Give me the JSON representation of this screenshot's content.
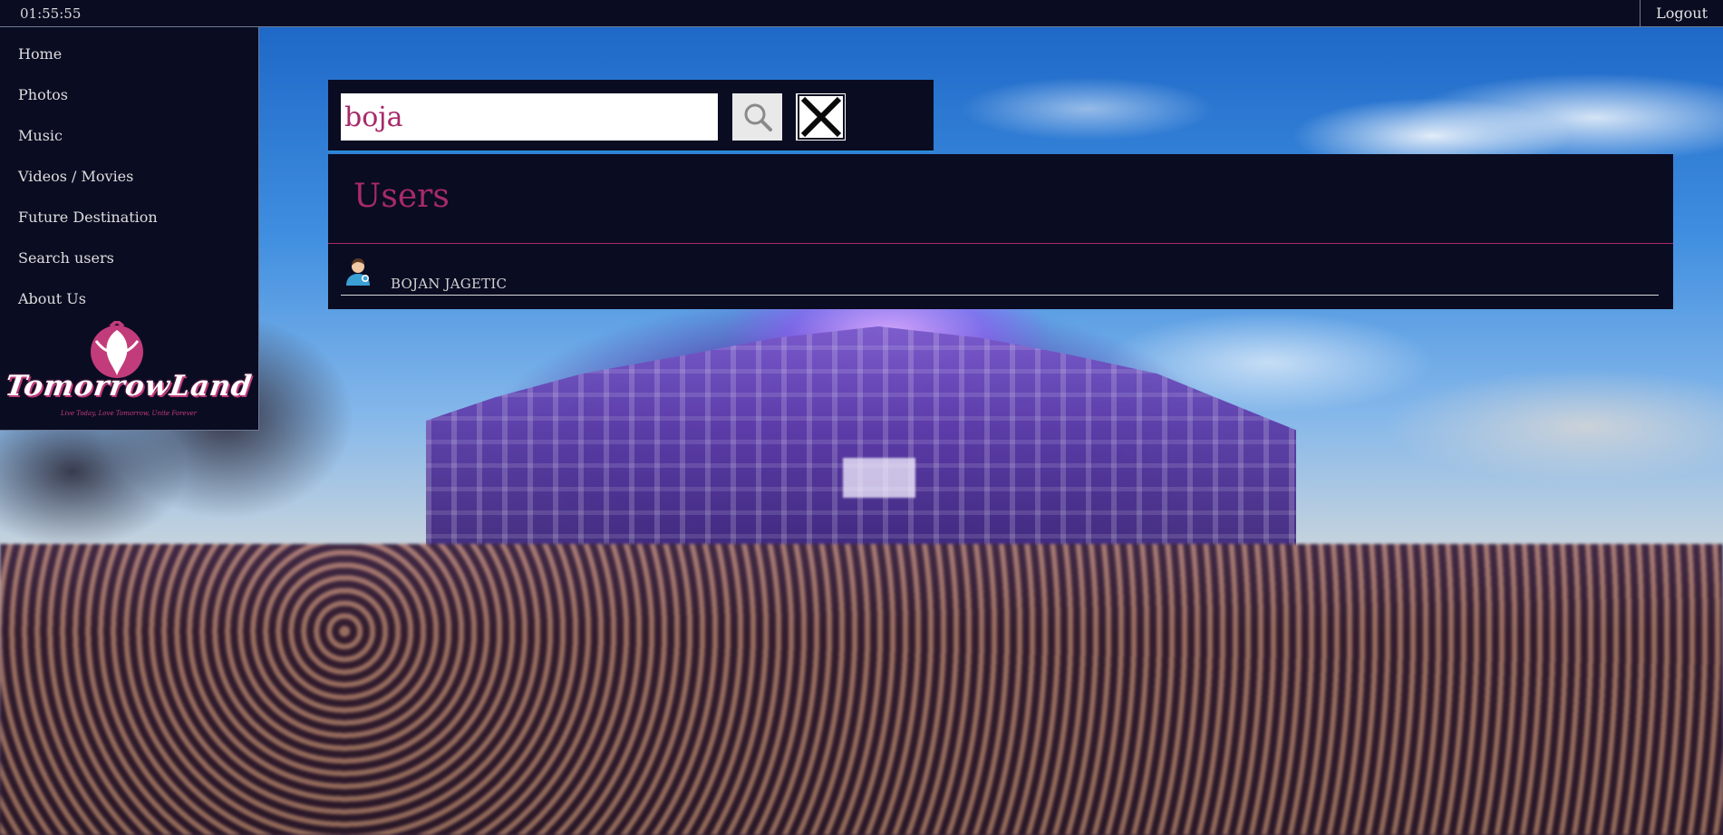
{
  "topbar": {
    "clock": "01:55:55",
    "logout_label": "Logout"
  },
  "sidebar": {
    "items": [
      {
        "label": "Home",
        "icon": ""
      },
      {
        "label": "Photos",
        "icon": ""
      },
      {
        "label": "Music",
        "icon": ""
      },
      {
        "label": "Videos / Movies",
        "icon": ""
      },
      {
        "label": "Future Destination",
        "icon": ""
      },
      {
        "label": "Search users",
        "icon": ""
      },
      {
        "label": "About Us",
        "icon": ""
      }
    ],
    "logo": {
      "text": "TomorrowLand",
      "tagline": "Live Today, Love Tomorrow, Unite Forever",
      "color": "#c23b7a"
    }
  },
  "search": {
    "value": "boja",
    "search_icon": "search-icon",
    "clear_icon": "close-icon"
  },
  "results": {
    "title": "Users",
    "users": [
      {
        "name": "BOJAN JAGETIC",
        "icon": "user-avatar-icon"
      }
    ]
  },
  "colors": {
    "panel_bg": "#0a0c22",
    "accent": "#a72a6a",
    "divider_blue": "#2a8bd8"
  }
}
